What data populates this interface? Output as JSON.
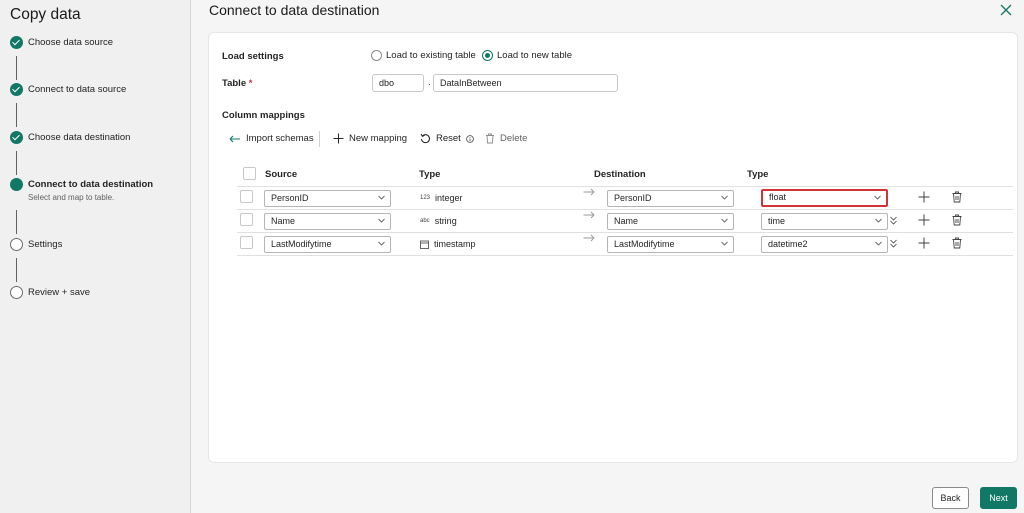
{
  "rail": {
    "title": "Copy data",
    "steps": [
      {
        "label": "Choose data source"
      },
      {
        "label": "Connect to data source"
      },
      {
        "label": "Choose data destination"
      },
      {
        "label": "Connect to data destination",
        "sub": "Select and map to table."
      },
      {
        "label": "Settings"
      },
      {
        "label": "Review + save"
      }
    ]
  },
  "header": {
    "title": "Connect to data destination"
  },
  "load_settings": {
    "label": "Load settings",
    "option_existing": "Load to existing table",
    "option_new": "Load to new table",
    "selected": "Load to new table"
  },
  "table": {
    "label": "Table",
    "required_mark": "*",
    "schema": "dbo",
    "separator": ".",
    "name": "DataInBetween"
  },
  "mappings": {
    "label": "Column mappings",
    "toolbar": {
      "import": "Import schemas",
      "new": "New mapping",
      "reset": "Reset",
      "delete": "Delete"
    },
    "headers": {
      "source": "Source",
      "type": "Type",
      "destination": "Destination",
      "dest_type": "Type"
    },
    "rows": [
      {
        "source": "PersonID",
        "type_glyph": "123",
        "type": "integer",
        "destination": "PersonID",
        "dest_type": "float"
      },
      {
        "source": "Name",
        "type_glyph": "abc",
        "type": "string",
        "destination": "Name",
        "dest_type": "time"
      },
      {
        "source": "LastModifytime",
        "type_glyph": "calendar-icon",
        "type": "timestamp",
        "destination": "LastModifytime",
        "dest_type": "datetime2"
      }
    ]
  },
  "footer": {
    "back": "Back",
    "next": "Next"
  },
  "colors": {
    "accent": "#117865",
    "highlight": "#d13438"
  }
}
